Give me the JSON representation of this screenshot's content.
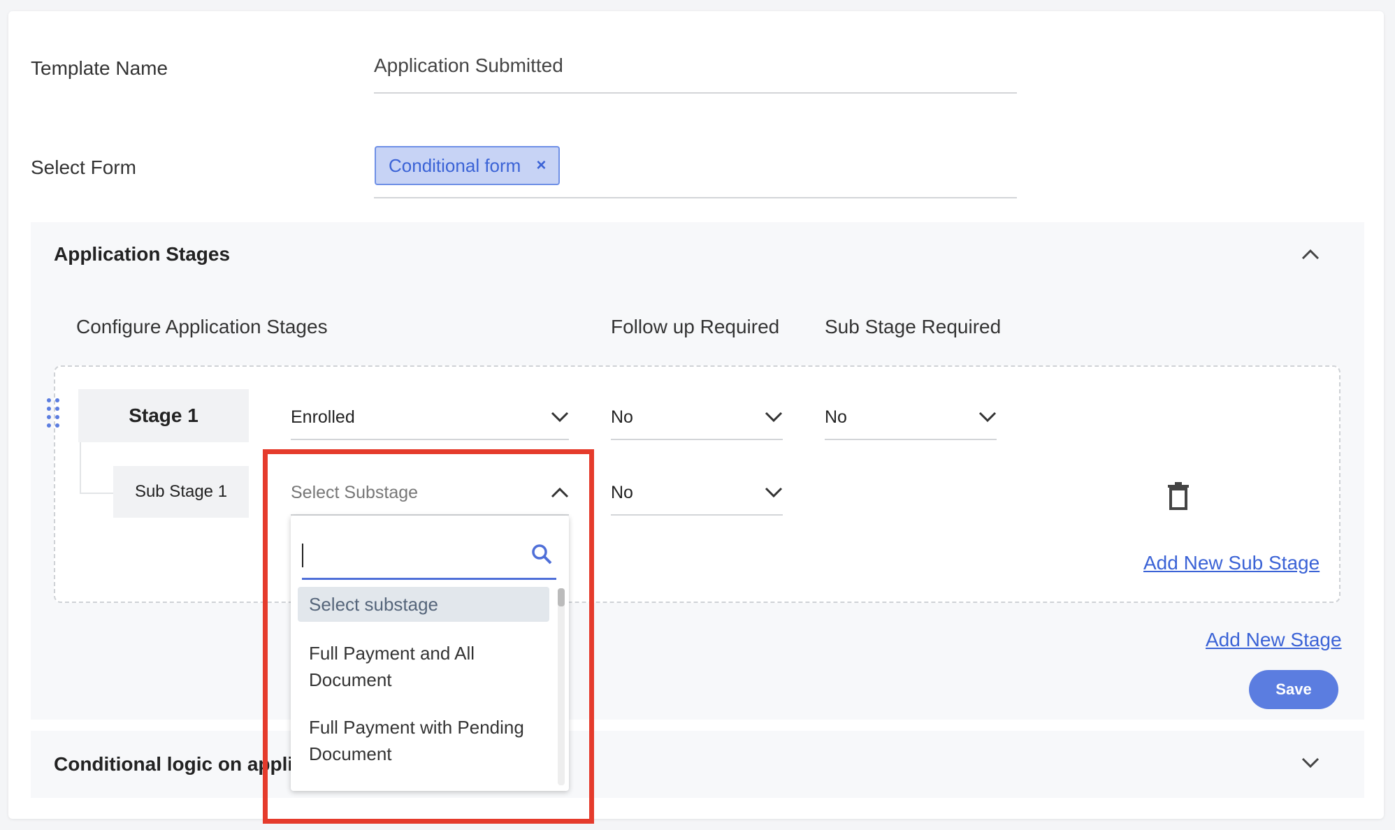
{
  "form": {
    "template_name_label": "Template Name",
    "template_name_value": "Application Submitted",
    "select_form_label": "Select Form",
    "selected_form_chip": "Conditional form",
    "chip_remove": "×"
  },
  "stages_panel": {
    "title": "Application Stages",
    "col_configure": "Configure Application Stages",
    "col_follow_up": "Follow up Required",
    "col_sub_stage": "Sub Stage Required",
    "stage": {
      "name": "Stage 1",
      "status": "Enrolled",
      "follow_up": "No",
      "sub_stage_required": "No"
    },
    "sub_stage": {
      "name": "Sub Stage 1",
      "placeholder": "Select Substage",
      "follow_up": "No"
    },
    "add_sub_stage": "Add New Sub Stage",
    "add_stage": "Add New Stage",
    "save": "Save"
  },
  "dropdown": {
    "search_value": "",
    "options": [
      "Select substage",
      "Full Payment and All Document",
      "Full Payment with Pending Document"
    ]
  },
  "conditional_panel": {
    "title": "Conditional logic on appli"
  },
  "colors": {
    "accent": "#5b7de0",
    "highlight": "#e53b2c"
  }
}
